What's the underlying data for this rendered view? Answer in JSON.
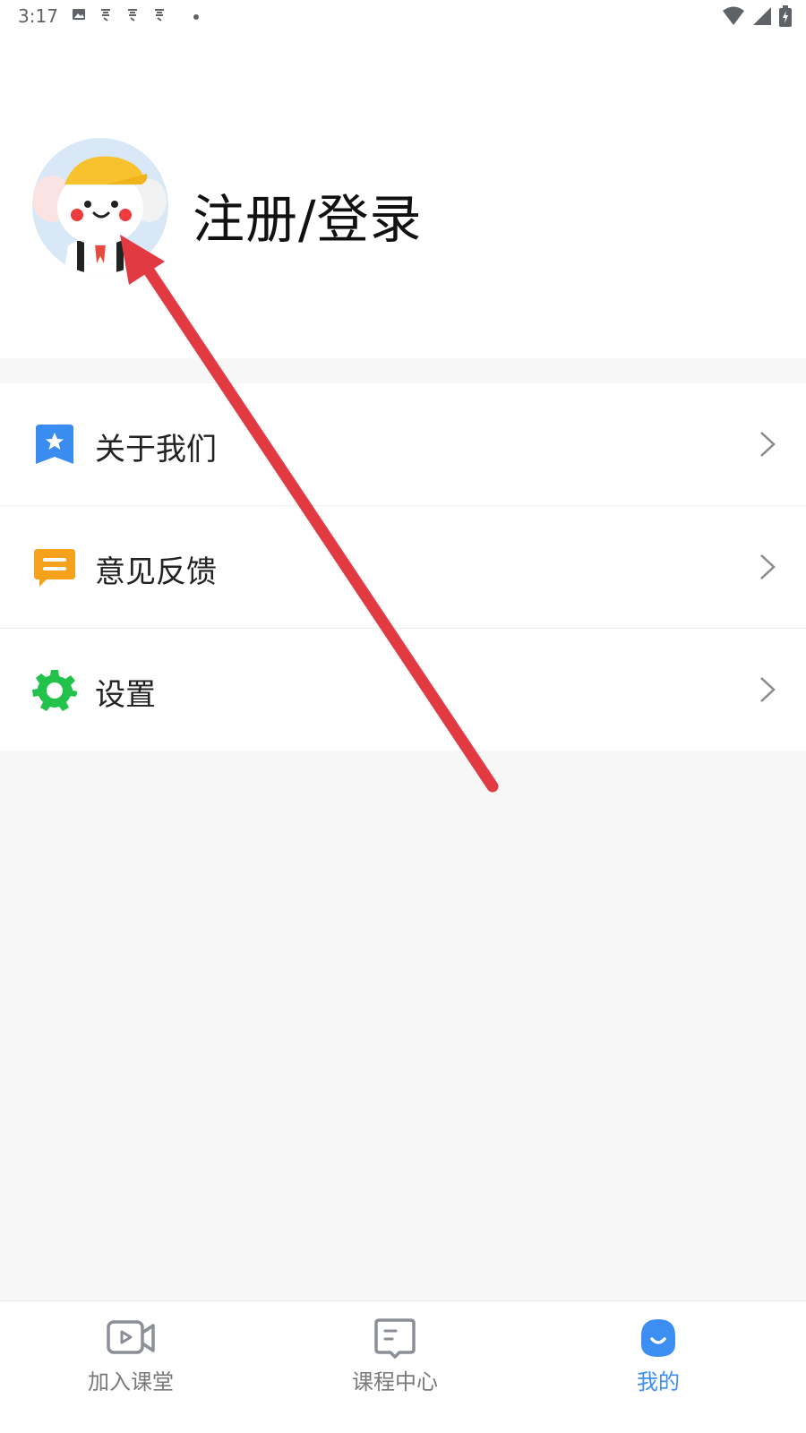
{
  "status_bar": {
    "time": "3:17"
  },
  "profile": {
    "login_label": "注册/登录",
    "avatar_icon": "mouse-mascot-avatar-icon"
  },
  "menu": {
    "items": [
      {
        "label": "关于我们",
        "icon": "bookmark-star-icon",
        "icon_color": "#3a8cf0"
      },
      {
        "label": "意见反馈",
        "icon": "chat-bubble-icon",
        "icon_color": "#f5a11b"
      },
      {
        "label": "设置",
        "icon": "gear-icon",
        "icon_color": "#23c24a"
      }
    ]
  },
  "bottom_nav": {
    "items": [
      {
        "label": "加入课堂",
        "icon": "video-camera-icon",
        "active": false
      },
      {
        "label": "课程中心",
        "icon": "book-icon",
        "active": false
      },
      {
        "label": "我的",
        "icon": "user-icon",
        "active": true
      }
    ],
    "active_color": "#3c8ef3",
    "inactive_color": "#7a7a7a"
  },
  "annotation": {
    "arrow_color": "#e23a43"
  }
}
